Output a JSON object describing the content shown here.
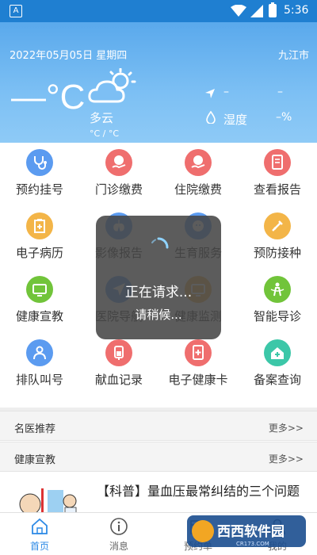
{
  "status_bar": {
    "time": "5:36",
    "left_icon_letter": "A"
  },
  "weather": {
    "date": "2022年05月05日 星期四",
    "city": "九江市",
    "temperature": "—°C",
    "condition": "多云",
    "range": "°C / °C",
    "wind_direction_value": "–",
    "wind_speed_value": "–",
    "humidity_label": "湿度",
    "humidity_value": "–%"
  },
  "services": [
    {
      "label": "预约挂号",
      "icon": "stethoscope-icon",
      "color": "#5b9bf0"
    },
    {
      "label": "门诊缴费",
      "icon": "yen-hand-icon",
      "color": "#ef6e6e"
    },
    {
      "label": "住院缴费",
      "icon": "yen-hand-icon",
      "color": "#ef6e6e"
    },
    {
      "label": "查看报告",
      "icon": "report-icon",
      "color": "#ef6e6e"
    },
    {
      "label": "电子病历",
      "icon": "clipboard-icon",
      "color": "#f3b548"
    },
    {
      "label": "影像报告",
      "icon": "lungs-icon",
      "color": "#5b9bf0"
    },
    {
      "label": "生育服务",
      "icon": "baby-icon",
      "color": "#5b9bf0"
    },
    {
      "label": "预防接种",
      "icon": "syringe-icon",
      "color": "#f3b548"
    },
    {
      "label": "健康宣教",
      "icon": "monitor-icon",
      "color": "#71c43a"
    },
    {
      "label": "医院导航",
      "icon": "navigation-icon",
      "color": "#5b9bf0"
    },
    {
      "label": "健康监测",
      "icon": "monitor-icon",
      "color": "#f3b548"
    },
    {
      "label": "智能导诊",
      "icon": "guide-person-icon",
      "color": "#71c43a"
    },
    {
      "label": "排队叫号",
      "icon": "person-icon",
      "color": "#5b9bf0"
    },
    {
      "label": "献血记录",
      "icon": "blood-bag-icon",
      "color": "#ef6e6e"
    },
    {
      "label": "电子健康卡",
      "icon": "health-card-icon",
      "color": "#ef6e6e"
    },
    {
      "label": "备案查询",
      "icon": "home-plus-icon",
      "color": "#3cc7a8"
    }
  ],
  "sections": {
    "doctors": {
      "title": "名医推荐",
      "more": "更多>>"
    },
    "education": {
      "title": "健康宣教",
      "more": "更多>>"
    }
  },
  "news": {
    "title": "【科普】量血压最常纠结的三个问题"
  },
  "tabs": [
    {
      "label": "首页",
      "icon": "home-icon",
      "active": true
    },
    {
      "label": "消息",
      "icon": "info-icon",
      "active": false
    },
    {
      "label": "预约单",
      "icon": "calendar-icon",
      "active": false
    },
    {
      "label": "我的",
      "icon": "user-icon",
      "active": false
    }
  ],
  "loading": {
    "line1": "正在请求...",
    "line2": "请稍候..."
  },
  "watermark": {
    "text": "西西软件园",
    "sub": "CR173.COM"
  },
  "colors": {
    "primary": "#2d8ae6",
    "header_top": "#1f7fd1"
  }
}
